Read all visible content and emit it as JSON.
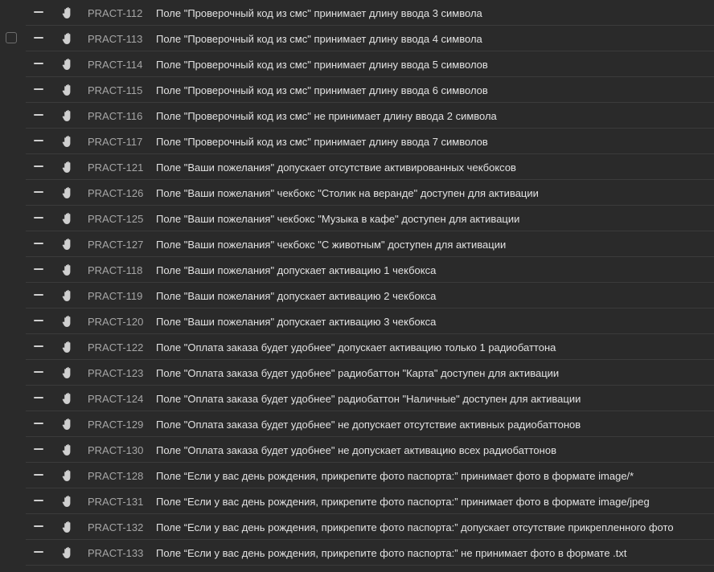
{
  "colors": {
    "background": "#2a2a2a",
    "separator": "#3b3b3b",
    "key_text": "#a6a6a6",
    "title_text": "#e2e2e2",
    "icon": "#cfcfcf"
  },
  "row_icons": {
    "priority": "minus-priority-icon",
    "status": "hand-icon"
  },
  "tests": [
    {
      "key": "PRACT-112",
      "title": "Поле \"Проверочный код из смс\" принимает длину ввода 3 символа"
    },
    {
      "key": "PRACT-113",
      "title": "Поле \"Проверочный код из смс\" принимает длину ввода 4 символа"
    },
    {
      "key": "PRACT-114",
      "title": "Поле \"Проверочный код из смс\" принимает длину ввода 5 символов"
    },
    {
      "key": "PRACT-115",
      "title": "Поле \"Проверочный код из смс\" принимает длину ввода 6 символов"
    },
    {
      "key": "PRACT-116",
      "title": "Поле \"Проверочный код из смс\" не принимает длину ввода 2 символа"
    },
    {
      "key": "PRACT-117",
      "title": "Поле \"Проверочный код из смс\" принимает длину ввода 7 символов"
    },
    {
      "key": "PRACT-121",
      "title": "Поле \"Ваши пожелания\" допускает отсутствие активированных чекбоксов"
    },
    {
      "key": "PRACT-126",
      "title": "Поле \"Ваши пожелания\" чекбокс \"Столик на веранде\" доступен для активации"
    },
    {
      "key": "PRACT-125",
      "title": "Поле \"Ваши пожелания\" чекбокс \"Музыка в кафе\" доступен для активации"
    },
    {
      "key": "PRACT-127",
      "title": "Поле \"Ваши пожелания\" чекбокс \"С животным\" доступен для активации"
    },
    {
      "key": "PRACT-118",
      "title": "Поле \"Ваши пожелания\" допускает активацию 1 чекбокса"
    },
    {
      "key": "PRACT-119",
      "title": "Поле \"Ваши пожелания\" допускает активацию 2 чекбокса"
    },
    {
      "key": "PRACT-120",
      "title": "Поле \"Ваши пожелания\" допускает активацию 3 чекбокса"
    },
    {
      "key": "PRACT-122",
      "title": "Поле \"Оплата заказа будет удобнее\" допускает активацию только 1 радиобаттона"
    },
    {
      "key": "PRACT-123",
      "title": "Поле \"Оплата заказа будет удобнее\" радиобаттон \"Карта\" доступен для активации"
    },
    {
      "key": "PRACT-124",
      "title": "Поле \"Оплата заказа будет удобнее\" радиобаттон \"Наличные\" доступен для активации"
    },
    {
      "key": "PRACT-129",
      "title": "Поле \"Оплата заказа будет удобнее\" не допускает отсутствие активных радиобаттонов"
    },
    {
      "key": "PRACT-130",
      "title": "Поле \"Оплата заказа будет удобнее\" не допускает активацию всех радиобаттонов"
    },
    {
      "key": "PRACT-128",
      "title": "Поле “Если у вас день рождения, прикрепите фото паспорта:” принимает фото в формате image/*"
    },
    {
      "key": "PRACT-131",
      "title": "Поле “Если у вас день рождения, прикрепите фото паспорта:” принимает фото в формате image/jpeg"
    },
    {
      "key": "PRACT-132",
      "title": "Поле “Если у вас день рождения, прикрепите фото паспорта:” допускает отсутствие прикрепленного фото"
    },
    {
      "key": "PRACT-133",
      "title": "Поле “Если у вас день рождения, прикрепите фото паспорта:” не принимает фото в формате .txt"
    }
  ]
}
